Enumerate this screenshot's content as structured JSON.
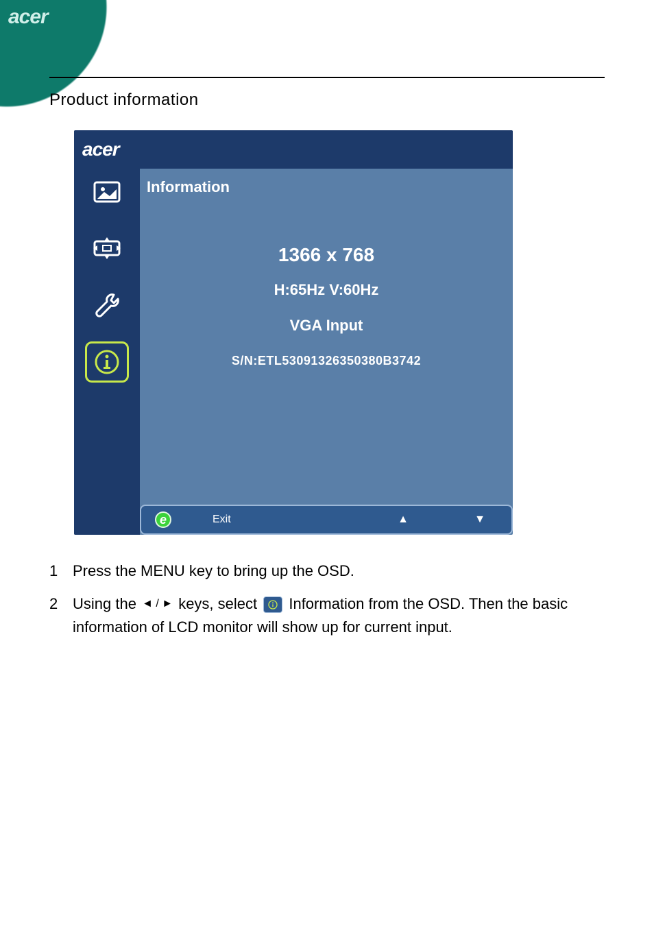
{
  "brand": "acer",
  "section_title": "Product information",
  "osd": {
    "panel_title": "Information",
    "resolution": "1366 x 768",
    "refresh": "H:65Hz  V:60Hz",
    "input": "VGA Input",
    "serial": "S/N:ETL53091326350380B3742",
    "footer": {
      "eco": "e",
      "exit": "Exit",
      "up": "▲",
      "down": "▼"
    },
    "tabs": [
      "picture",
      "position",
      "settings",
      "information"
    ]
  },
  "instructions": {
    "items": [
      {
        "num": "1",
        "text_a": "Press the MENU key to bring up the OSD."
      },
      {
        "num": "2",
        "text_a": "Using the ",
        "nav": "◄ / ►",
        "text_b": " keys, select ",
        "text_c": " Information from the OSD. Then the basic information of LCD monitor will show up for current input."
      }
    ]
  }
}
